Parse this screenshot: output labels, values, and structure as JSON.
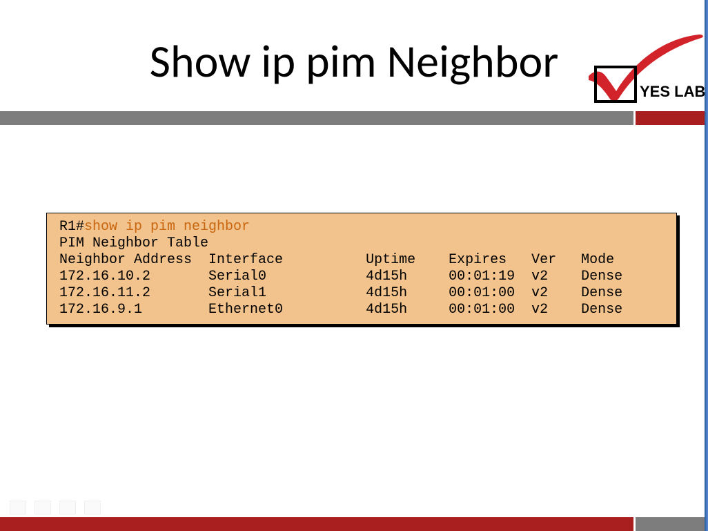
{
  "slide": {
    "title": "Show ip pim Neighbor"
  },
  "logo": {
    "text": "YES LAB"
  },
  "terminal": {
    "prompt": "R1#",
    "command": "show ip pim neighbor",
    "heading": "PIM Neighbor Table",
    "columns": {
      "addr": "Neighbor Address",
      "iface": "Interface",
      "uptime": "Uptime",
      "expires": "Expires",
      "ver": "Ver",
      "mode": "Mode"
    },
    "rows": [
      {
        "addr": "172.16.10.2",
        "iface": "Serial0",
        "uptime": "4d15h",
        "expires": "00:01:19",
        "ver": "v2",
        "mode": "Dense"
      },
      {
        "addr": "172.16.11.2",
        "iface": "Serial1",
        "uptime": "4d15h",
        "expires": "00:01:00",
        "ver": "v2",
        "mode": "Dense"
      },
      {
        "addr": "172.16.9.1",
        "iface": "Ethernet0",
        "uptime": "4d15h",
        "expires": "00:01:00",
        "ver": "v2",
        "mode": "Dense"
      }
    ]
  }
}
